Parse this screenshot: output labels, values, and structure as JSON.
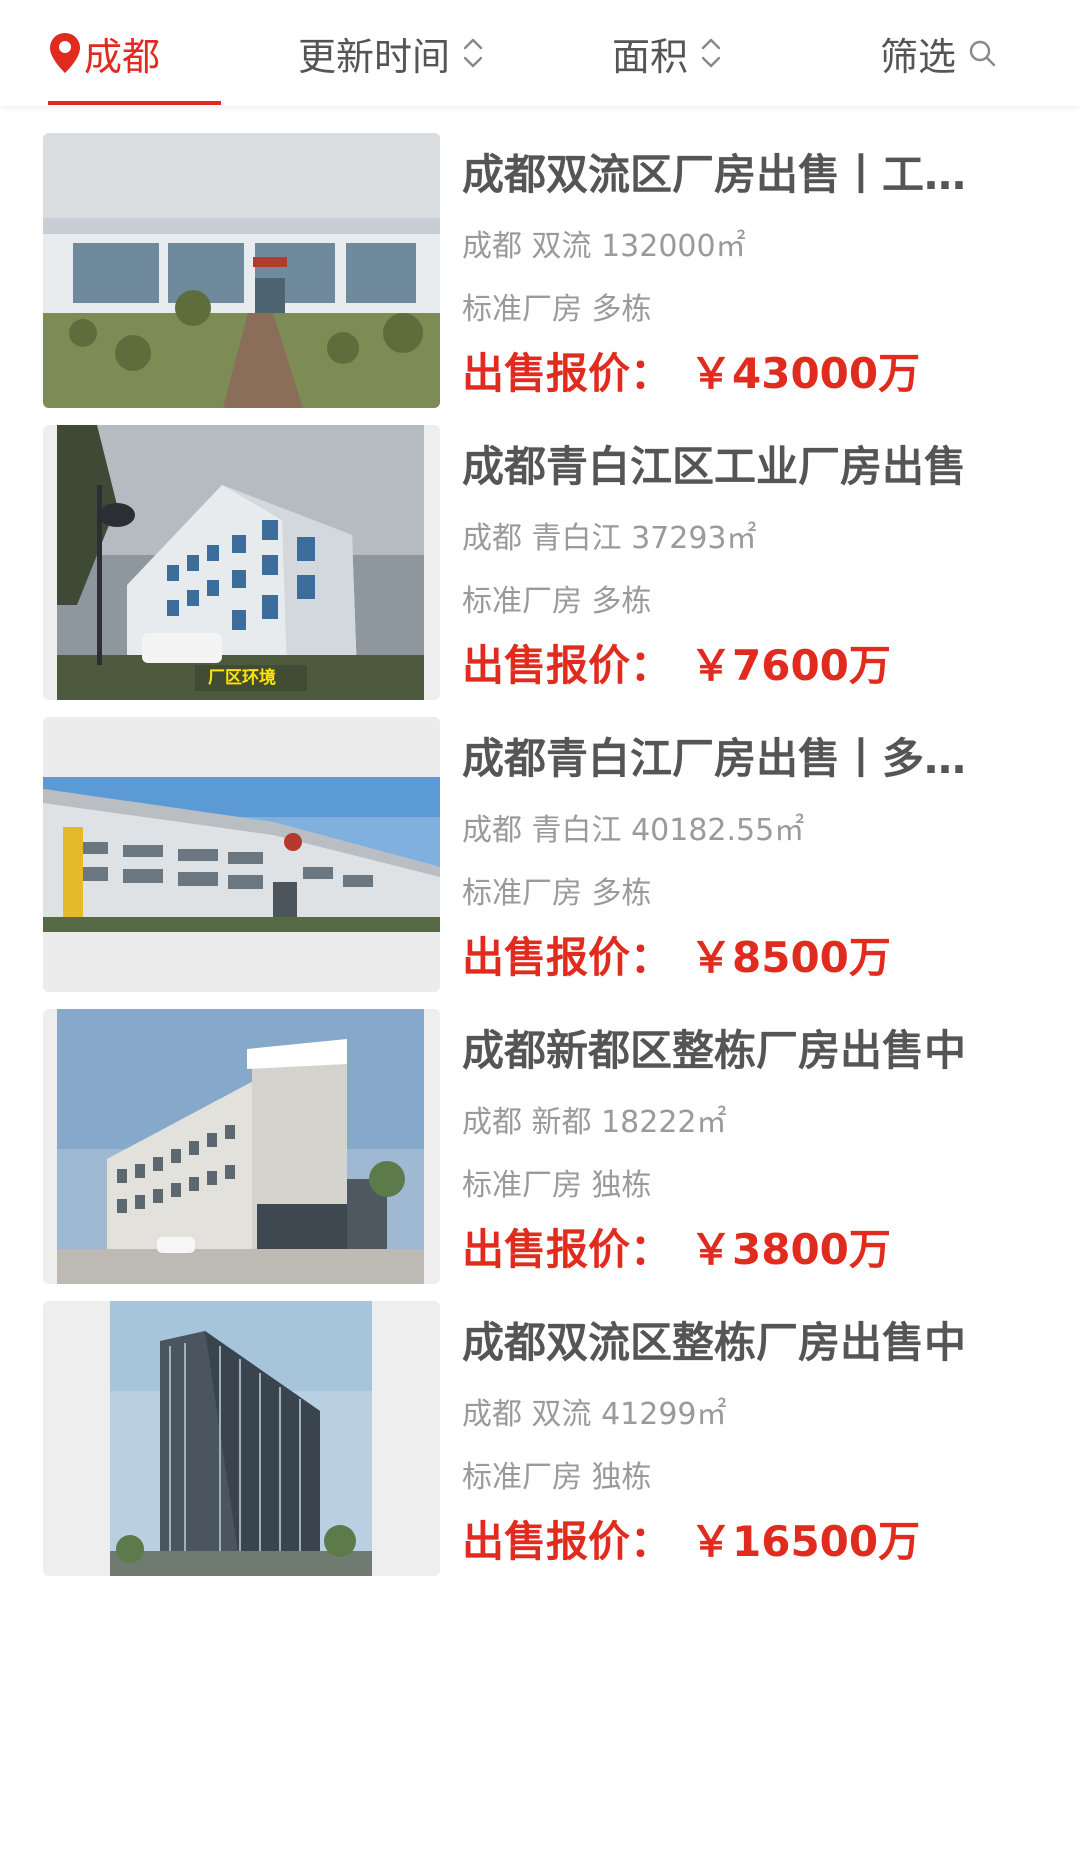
{
  "filter_bar": {
    "city": "成都",
    "update_time": "更新时间",
    "area": "面积",
    "filter": "筛选",
    "accent_color": "#e02b1e"
  },
  "listings": [
    {
      "title": "成都双流区厂房出售丨工业园区独栋厂房",
      "meta": "成都 双流 132000㎡",
      "tags": "标准厂房 多栋",
      "price_label": "出售报价：",
      "price_value": "￥43000万"
    },
    {
      "title": "成都青白江区工业厂房出售",
      "meta": "成都 青白江 37293㎡",
      "tags": "标准厂房 多栋",
      "price_label": "出售报价：",
      "price_value": "￥7600万",
      "image_caption": "厂区环境"
    },
    {
      "title": "成都青白江厂房出售丨多栋标准厂房",
      "meta": "成都 青白江 40182.55㎡",
      "tags": "标准厂房 多栋",
      "price_label": "出售报价：",
      "price_value": "￥8500万"
    },
    {
      "title": "成都新都区整栋厂房出售中",
      "meta": "成都 新都 18222㎡",
      "tags": "标准厂房 独栋",
      "price_label": "出售报价：",
      "price_value": "￥3800万"
    },
    {
      "title": "成都双流区整栋厂房出售中",
      "meta": "成都 双流 41299㎡",
      "tags": "标准厂房 独栋",
      "price_label": "出售报价：",
      "price_value": "￥16500万"
    }
  ]
}
